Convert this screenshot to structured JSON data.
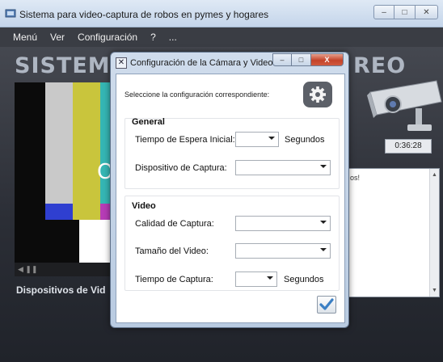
{
  "window": {
    "title": "Sistema para video-captura de robos en pymes y hogares",
    "buttons": {
      "minimize": "–",
      "maximize": "□",
      "close": "✕"
    }
  },
  "menu": [
    "Menú",
    "Ver",
    "Configuración",
    "?",
    "..."
  ],
  "app": {
    "banner_left": "SISTEMA",
    "banner_right": "REO",
    "video_char": "O",
    "video_control": "◀ ❚❚",
    "clock": "0:36:28",
    "log_text": "os!",
    "devices_label": "Dispositivos de Vid",
    "test_pattern_colors": [
      "#c8c8c8",
      "#c9c53c",
      "#35b6b4",
      "#3bb63b",
      "#b73cb7",
      "#c43434",
      "#3438c4"
    ]
  },
  "dialog": {
    "title": "Configuración de la Cámara y Video",
    "buttons": {
      "minimize": "–",
      "maximize": "□",
      "close": "X"
    },
    "prompt": "Seleccione la configuración correspondiente:",
    "general": {
      "title": "General",
      "wait_label": "Tiempo de Espera Inicial:",
      "wait_value": "",
      "wait_unit": "Segundos",
      "device_label": "Dispositivo de Captura:",
      "device_value": ""
    },
    "video": {
      "title": "Video",
      "quality_label": "Calidad de Captura:",
      "quality_value": "",
      "size_label": "Tamaño del Video:",
      "size_value": "",
      "time_label": "Tiempo de Captura:",
      "time_value": "",
      "time_unit": "Segundos"
    }
  },
  "colors": {
    "app_background": "#2b2e36",
    "menubar": "#3a3d44",
    "accent_blue": "#3a7fc4"
  }
}
